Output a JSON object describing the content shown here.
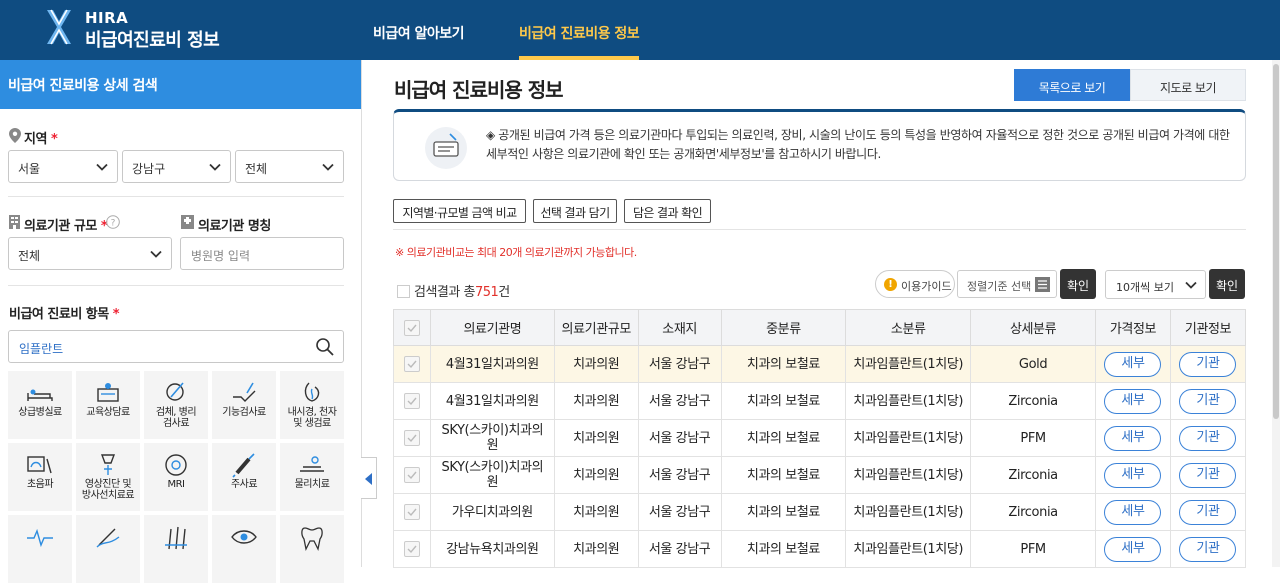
{
  "header": {
    "brand_top": "HIRA",
    "brand_bottom": "비급여진료비 정보",
    "nav": [
      "비급여 알아보기",
      "비급여 진료비용 정보"
    ],
    "active_color": "#ffc94a",
    "bg_color": "#0f4c81"
  },
  "sidebar": {
    "title": "비급여 진료비용 상세 검색",
    "region_label": "지역",
    "region": [
      "서울",
      "강남구",
      "전체"
    ],
    "scale_label": "의료기관 규모",
    "scale_value": "전체",
    "name_label": "의료기관 명칭",
    "name_placeholder": "병원명 입력",
    "item_label": "비급여 진료비 항목",
    "item_value": "임플란트",
    "categories": [
      {
        "label": "상급병실료",
        "icon": "hospital-bed-icon"
      },
      {
        "label": "교육상담료",
        "icon": "consultation-icon"
      },
      {
        "label": "검체, 병리\n검사료",
        "icon": "specimen-icon"
      },
      {
        "label": "기능검사료",
        "icon": "function-test-icon"
      },
      {
        "label": "내시경, 천자\n및 생검료",
        "icon": "endoscope-icon"
      },
      {
        "label": "초음파",
        "icon": "ultrasound-icon"
      },
      {
        "label": "영상진단 및\n방사선치료료",
        "icon": "radiation-icon"
      },
      {
        "label": "MRI",
        "icon": "mri-icon"
      },
      {
        "label": "주사료",
        "icon": "syringe-icon"
      },
      {
        "label": "물리치료",
        "icon": "physical-therapy-icon"
      },
      {
        "label": "",
        "icon": "heartbeat-icon"
      },
      {
        "label": "",
        "icon": "surgery-icon"
      },
      {
        "label": "",
        "icon": "acupuncture-icon"
      },
      {
        "label": "",
        "icon": "eye-icon"
      },
      {
        "label": "",
        "icon": "tooth-icon"
      }
    ]
  },
  "main": {
    "title": "비급여 진료비용 정보",
    "view_list": "목록으로 보기",
    "view_map": "지도로 보기",
    "notice": "◈ 공개된 비급여 가격 등은 의료기관마다 투입되는 의료인력, 장비, 시술의 난이도 등의 특성을 반영하여 자율적으로 정한 것으로 공개된 비급여 가격에 대한 세부적인 사항은 의료기관에 확인 또는 공개화면'세부정보'를 참고하시기 바랍니다.",
    "buttons": [
      "지역별·규모별 금액 비교",
      "선택 결과 담기",
      "담은 결과 확인"
    ],
    "warning": "※ 의료기관비교는 최대 20개 의료기관까지 가능합니다.",
    "count_prefix": "검색결과 총",
    "count": "751",
    "count_suffix": "건",
    "guide": "이용가이드",
    "sort_placeholder": "정렬기준 선택",
    "confirm": "확인",
    "page_size": "10개씩 보기",
    "columns": [
      "의료기관명",
      "의료기관규모",
      "소재지",
      "중분류",
      "소분류",
      "상세분류",
      "가격정보",
      "기관정보"
    ],
    "rows": [
      {
        "name": "4월31일치과의원",
        "scale": "치과의원",
        "loc": "서울 강남구",
        "mid": "치과의 보철료",
        "sub": "치과임플란트(1치당)",
        "detail": "Gold",
        "price": "세부",
        "inst": "기관"
      },
      {
        "name": "4월31일치과의원",
        "scale": "치과의원",
        "loc": "서울 강남구",
        "mid": "치과의 보철료",
        "sub": "치과임플란트(1치당)",
        "detail": "Zirconia",
        "price": "세부",
        "inst": "기관"
      },
      {
        "name": "SKY(스카이)치과의\n원",
        "scale": "치과의원",
        "loc": "서울 강남구",
        "mid": "치과의 보철료",
        "sub": "치과임플란트(1치당)",
        "detail": "PFM",
        "price": "세부",
        "inst": "기관"
      },
      {
        "name": "SKY(스카이)치과의\n원",
        "scale": "치과의원",
        "loc": "서울 강남구",
        "mid": "치과의 보철료",
        "sub": "치과임플란트(1치당)",
        "detail": "Zirconia",
        "price": "세부",
        "inst": "기관"
      },
      {
        "name": "가우디치과의원",
        "scale": "치과의원",
        "loc": "서울 강남구",
        "mid": "치과의 보철료",
        "sub": "치과임플란트(1치당)",
        "detail": "Zirconia",
        "price": "세부",
        "inst": "기관"
      },
      {
        "name": "강남뉴욕치과의원",
        "scale": "치과의원",
        "loc": "서울 강남구",
        "mid": "치과의 보철료",
        "sub": "치과임플란트(1치당)",
        "detail": "PFM",
        "price": "세부",
        "inst": "기관"
      }
    ]
  }
}
